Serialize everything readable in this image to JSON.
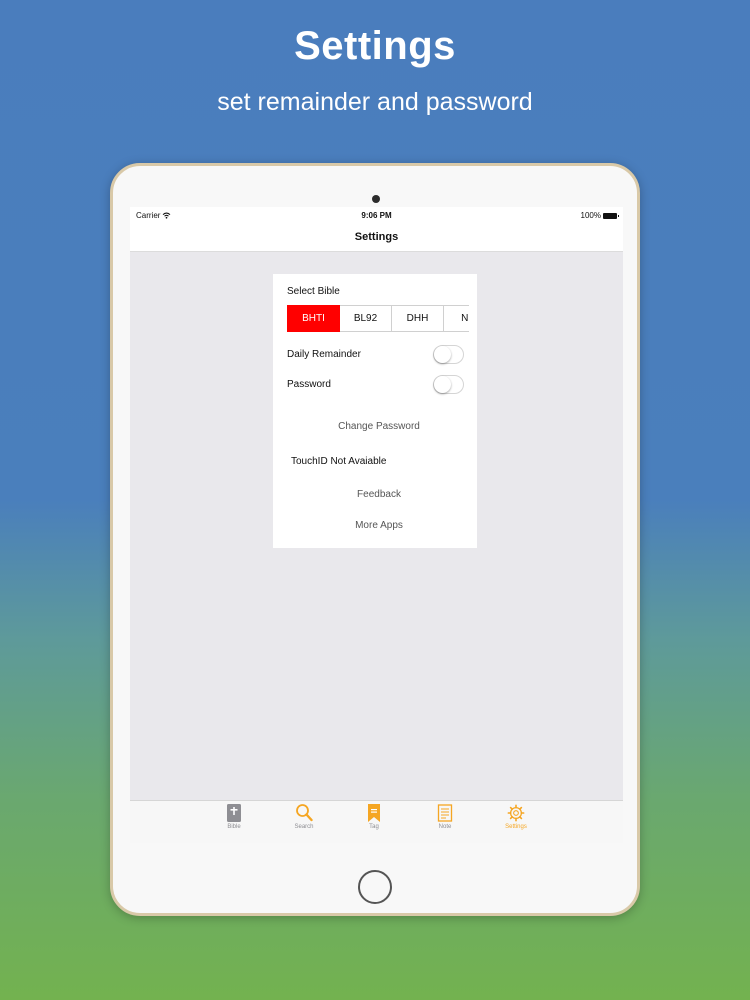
{
  "hero": {
    "title": "Settings",
    "subtitle": "set remainder and password"
  },
  "status_bar": {
    "carrier": "Carrier",
    "time": "9:06 PM",
    "battery": "100%"
  },
  "nav": {
    "title": "Settings"
  },
  "settings": {
    "select_bible_label": "Select Bible",
    "bibles": [
      {
        "label": "BHTI",
        "selected": true
      },
      {
        "label": "BL92",
        "selected": false
      },
      {
        "label": "DHH",
        "selected": false
      },
      {
        "label": "NBI",
        "selected": false
      }
    ],
    "daily_reminder": {
      "label": "Daily Remainder",
      "on": false
    },
    "password": {
      "label": "Password",
      "on": false
    },
    "change_password_label": "Change Password",
    "touchid_label": "TouchID Not Avaiable",
    "feedback_label": "Feedback",
    "more_apps_label": "More Apps"
  },
  "tab_bar": {
    "tabs": [
      {
        "label": "Bible",
        "icon": "bible-icon",
        "active": false
      },
      {
        "label": "Search",
        "icon": "search-icon",
        "active": false
      },
      {
        "label": "Tag",
        "icon": "bookmark-icon",
        "active": false
      },
      {
        "label": "Note",
        "icon": "note-icon",
        "active": false
      },
      {
        "label": "Settings",
        "icon": "gear-icon",
        "active": true
      }
    ]
  },
  "colors": {
    "accent": "#f5a623",
    "selected_segment": "#ff0000",
    "inactive_tab": "#8e8e93"
  }
}
